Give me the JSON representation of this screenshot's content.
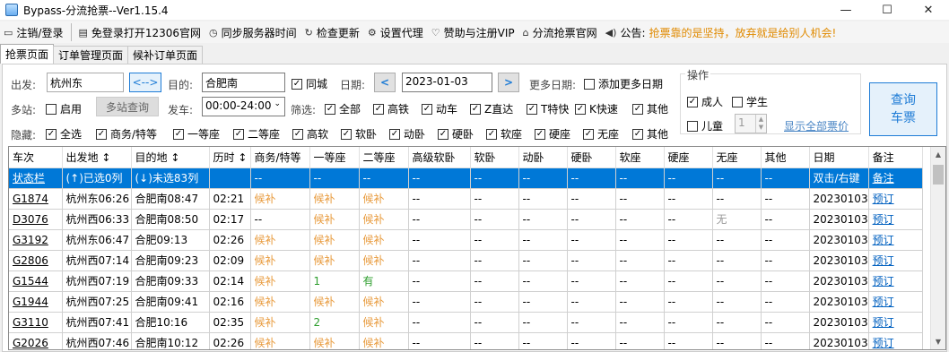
{
  "window": {
    "title": "Bypass-分流抢票--Ver1.15.4",
    "minimize": "—",
    "maximize": "☐",
    "close": "✕"
  },
  "menu": {
    "login": "注销/登录",
    "open_12306": "免登录打开12306官网",
    "sync_time": "同步服务器时间",
    "check_update": "检查更新",
    "proxy": "设置代理",
    "sponsor": "赞助与注册VIP",
    "official_site": "分流抢票官网",
    "notice_label": "公告:",
    "notice_text": "抢票靠的是坚持，放弃就是给别人机会!"
  },
  "tabs": [
    "抢票页面",
    "订单管理页面",
    "候补订单页面"
  ],
  "form": {
    "from_label": "出发:",
    "from_value": "杭州东",
    "swap": "<-->",
    "to_label": "目的:",
    "to_value": "合肥南",
    "same_city": "同城",
    "date_label": "日期:",
    "date_value": "2023-01-03",
    "prev": "<",
    "next": ">",
    "more_dates_label": "更多日期:",
    "add_more_dates": "添加更多日期",
    "multi_station_label": "多站:",
    "enable": "启用",
    "multi_query": "多站查询",
    "depart_label": "发车:",
    "depart_value": "00:00-24:00",
    "filter_label": "筛选:",
    "filters": [
      "全部",
      "高铁",
      "动车",
      "Z直达",
      "T特快",
      "K快速",
      "其他"
    ],
    "hide_label": "隐藏:",
    "hides": [
      "全选",
      "商务/特等",
      "一等座",
      "二等座",
      "高软",
      "软卧",
      "动卧",
      "硬卧",
      "软座",
      "硬座",
      "无座",
      "其他"
    ]
  },
  "ops": {
    "title": "操作",
    "adult": "成人",
    "student": "学生",
    "child": "儿童",
    "child_count": "1",
    "show_all_prices": "显示全部票价",
    "query": "查询",
    "query2": "车票"
  },
  "table": {
    "headers": [
      "车次",
      "出发地 ↕",
      "目的地 ↕",
      "历时 ↕",
      "商务/特等",
      "一等座",
      "二等座",
      "高级软卧",
      "软卧",
      "动卧",
      "硬卧",
      "软座",
      "硬座",
      "无座",
      "其他",
      "日期",
      "备注"
    ],
    "status_row": [
      "状态栏",
      "(↑)已选0列",
      "(↓)未选83列",
      "",
      "--",
      "--",
      "--",
      "--",
      "--",
      "--",
      "--",
      "--",
      "--",
      "--",
      "--",
      "双击/右键",
      "备注"
    ],
    "rows": [
      [
        "G1874",
        "杭州东06:26",
        "合肥南08:47",
        "02:21",
        "候补",
        "候补",
        "候补",
        "--",
        "--",
        "--",
        "--",
        "--",
        "--",
        "--",
        "--",
        "20230103",
        "预订"
      ],
      [
        "D3076",
        "杭州西06:33",
        "合肥南08:50",
        "02:17",
        "--",
        "候补",
        "候补",
        "--",
        "--",
        "--",
        "--",
        "--",
        "--",
        "无",
        "--",
        "20230103",
        "预订"
      ],
      [
        "G3192",
        "杭州东06:47",
        "合肥09:13",
        "02:26",
        "候补",
        "候补",
        "候补",
        "--",
        "--",
        "--",
        "--",
        "--",
        "--",
        "--",
        "--",
        "20230103",
        "预订"
      ],
      [
        "G2806",
        "杭州西07:14",
        "合肥南09:23",
        "02:09",
        "候补",
        "候补",
        "候补",
        "--",
        "--",
        "--",
        "--",
        "--",
        "--",
        "--",
        "--",
        "20230103",
        "预订"
      ],
      [
        "G1544",
        "杭州西07:19",
        "合肥南09:33",
        "02:14",
        "候补",
        "1",
        "有",
        "--",
        "--",
        "--",
        "--",
        "--",
        "--",
        "--",
        "--",
        "20230103",
        "预订"
      ],
      [
        "G1944",
        "杭州西07:25",
        "合肥南09:41",
        "02:16",
        "候补",
        "候补",
        "候补",
        "--",
        "--",
        "--",
        "--",
        "--",
        "--",
        "--",
        "--",
        "20230103",
        "预订"
      ],
      [
        "G3110",
        "杭州西07:41",
        "合肥10:16",
        "02:35",
        "候补",
        "2",
        "候补",
        "--",
        "--",
        "--",
        "--",
        "--",
        "--",
        "--",
        "--",
        "20230103",
        "预订"
      ],
      [
        "G2026",
        "杭州西07:46",
        "合肥南10:12",
        "02:26",
        "候补",
        "候补",
        "候补",
        "--",
        "--",
        "--",
        "--",
        "--",
        "--",
        "--",
        "--",
        "20230103",
        "预订"
      ]
    ]
  }
}
